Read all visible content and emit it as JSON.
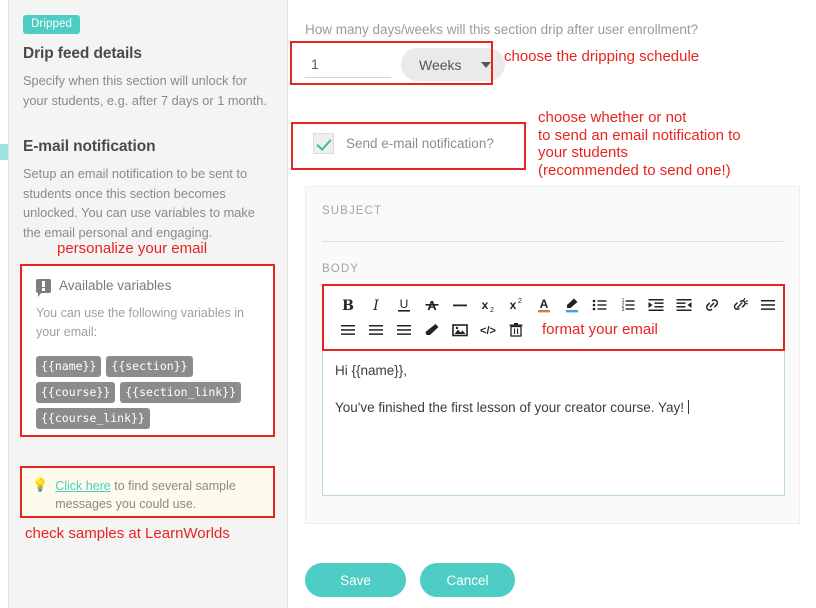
{
  "left_panel": {
    "badge": "Dripped",
    "drip_title": "Drip feed details",
    "drip_desc": "Specify when this section will unlock for your students, e.g. after 7 days or 1 month.",
    "email_title": "E-mail notification",
    "email_desc": "Setup an email notification to be sent to students once this section becomes unlocked. You can use variables to make the email personal and engaging.",
    "annotation_personalize": "personalize your email",
    "annotation_samples": "check samples at LearnWorlds",
    "variables_card": {
      "icon": "speech-bubble-alert-icon",
      "title": "Available variables",
      "subtitle": "You can use the following variables in your email:",
      "chips": [
        "{{name}}",
        "{{section}}",
        "{{course}}",
        "{{section_link}}",
        "{{course_link}}"
      ]
    },
    "sample_card": {
      "icon": "lightbulb-icon",
      "link_text": "Click here",
      "rest_text": " to find several sample messages you could use."
    }
  },
  "right_panel": {
    "question": "How many days/weeks will this section drip after user enrollment?",
    "drip_value": "1",
    "drip_unit": "Weeks",
    "annotation_schedule": "choose the dripping schedule",
    "checkbox_label": "Send e-mail notification?",
    "checkbox_checked": true,
    "annotation_email_lines": [
      "choose whether or not",
      "to send an email notification to",
      "your students",
      "(recommended to send one!)"
    ],
    "subject_label": "SUBJECT",
    "subject_value": "",
    "body_label": "BODY",
    "annotation_format": "format your email",
    "body_lines": [
      "Hi {{name}},",
      "You've finished the first lesson of your creator course. Yay!"
    ],
    "toolbar": {
      "row1": [
        "bold-icon",
        "italic-icon",
        "underline-icon",
        "strikethrough-icon",
        "horizontal-rule-icon",
        "subscript-icon",
        "superscript-icon",
        "text-color-icon",
        "highlight-color-icon",
        "bullet-list-icon",
        "numbered-list-icon",
        "indent-increase-icon",
        "indent-decrease-icon",
        "link-icon",
        "unlink-icon",
        "align-left-icon"
      ],
      "row2": [
        "align-center-icon",
        "align-right-icon",
        "align-justify-icon",
        "clear-format-icon",
        "insert-image-icon",
        "source-code-icon",
        "delete-icon"
      ]
    },
    "save_label": "Save",
    "cancel_label": "Cancel"
  },
  "colors": {
    "accent": "#4ecdc4",
    "annotation": "#e8241f",
    "panel_bg": "#f4f4f4",
    "check": "#3fbfa8"
  }
}
